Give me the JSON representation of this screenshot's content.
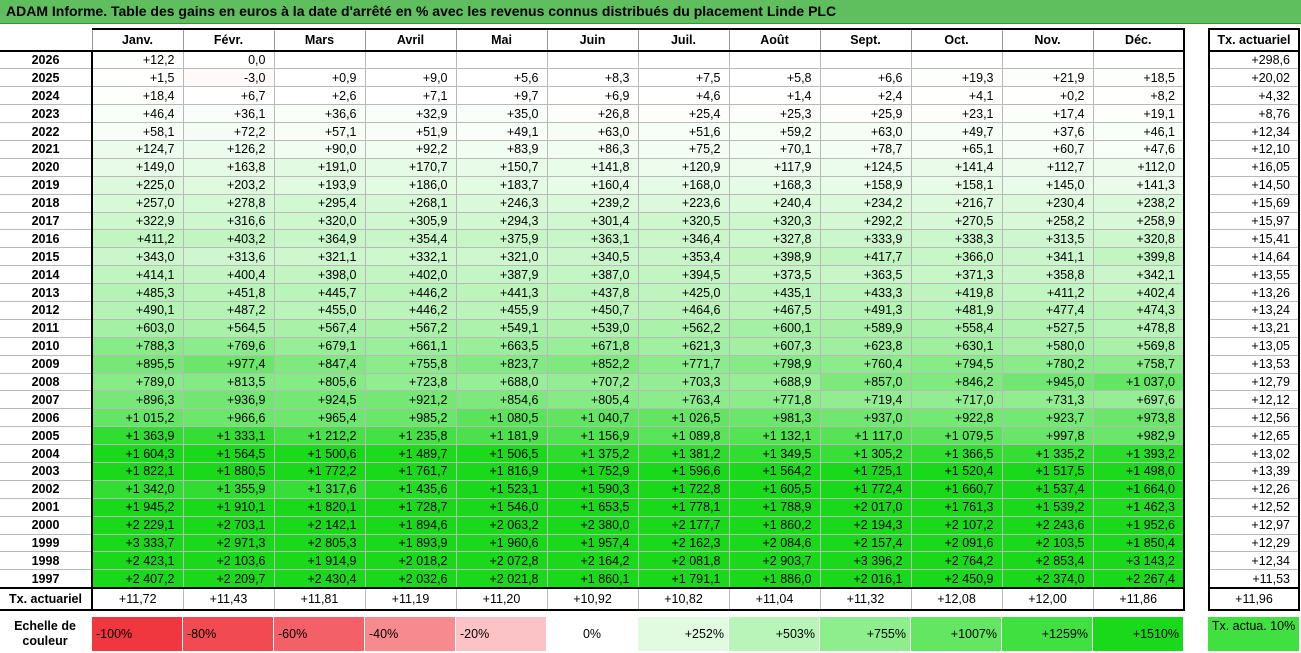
{
  "title": "ADAM Informe. Table des gains en euros à la date d'arrêté en % avec les revenus connus distribués du placement Linde PLC",
  "months": [
    "Janv.",
    "Févr.",
    "Mars",
    "Avril",
    "Mai",
    "Juin",
    "Juil.",
    "Août",
    "Sept.",
    "Oct.",
    "Nov.",
    "Déc."
  ],
  "side_header": "Tx. actuariel",
  "footer_label": "Tx. actuariel",
  "rows": [
    {
      "year": "2026",
      "vals": [
        "+12,2",
        "0,0",
        "",
        "",
        "",
        "",
        "",
        "",
        "",
        "",
        "",
        ""
      ],
      "tx": "+298,6"
    },
    {
      "year": "2025",
      "vals": [
        "+1,5",
        "-3,0",
        "+0,9",
        "+9,0",
        "+5,6",
        "+8,3",
        "+7,5",
        "+5,8",
        "+6,6",
        "+19,3",
        "+21,9",
        "+18,5"
      ],
      "tx": "+20,02"
    },
    {
      "year": "2024",
      "vals": [
        "+18,4",
        "+6,7",
        "+2,6",
        "+7,1",
        "+9,7",
        "+6,9",
        "+4,6",
        "+1,4",
        "+2,4",
        "+4,1",
        "+0,2",
        "+8,2"
      ],
      "tx": "+4,32"
    },
    {
      "year": "2023",
      "vals": [
        "+46,4",
        "+36,1",
        "+36,6",
        "+32,9",
        "+35,0",
        "+26,8",
        "+25,4",
        "+25,3",
        "+25,9",
        "+23,1",
        "+17,4",
        "+19,1"
      ],
      "tx": "+8,76"
    },
    {
      "year": "2022",
      "vals": [
        "+58,1",
        "+72,2",
        "+57,1",
        "+51,9",
        "+49,1",
        "+63,0",
        "+51,6",
        "+59,2",
        "+63,0",
        "+49,7",
        "+37,6",
        "+46,1"
      ],
      "tx": "+12,34"
    },
    {
      "year": "2021",
      "vals": [
        "+124,7",
        "+126,2",
        "+90,0",
        "+92,2",
        "+83,9",
        "+86,3",
        "+75,2",
        "+70,1",
        "+78,7",
        "+65,1",
        "+60,7",
        "+47,6"
      ],
      "tx": "+12,10"
    },
    {
      "year": "2020",
      "vals": [
        "+149,0",
        "+163,8",
        "+191,0",
        "+170,7",
        "+150,7",
        "+141,8",
        "+120,9",
        "+117,9",
        "+124,5",
        "+141,4",
        "+112,7",
        "+112,0"
      ],
      "tx": "+16,05"
    },
    {
      "year": "2019",
      "vals": [
        "+225,0",
        "+203,2",
        "+193,9",
        "+186,0",
        "+183,7",
        "+160,4",
        "+168,0",
        "+168,3",
        "+158,9",
        "+158,1",
        "+145,0",
        "+141,3"
      ],
      "tx": "+14,50"
    },
    {
      "year": "2018",
      "vals": [
        "+257,0",
        "+278,8",
        "+295,4",
        "+268,1",
        "+246,3",
        "+239,2",
        "+223,6",
        "+240,4",
        "+234,2",
        "+216,7",
        "+230,4",
        "+238,2"
      ],
      "tx": "+15,69"
    },
    {
      "year": "2017",
      "vals": [
        "+322,9",
        "+316,6",
        "+320,0",
        "+305,9",
        "+294,3",
        "+301,4",
        "+320,5",
        "+320,3",
        "+292,2",
        "+270,5",
        "+258,2",
        "+258,9"
      ],
      "tx": "+15,97"
    },
    {
      "year": "2016",
      "vals": [
        "+411,2",
        "+403,2",
        "+364,9",
        "+354,4",
        "+375,9",
        "+363,1",
        "+346,4",
        "+327,8",
        "+333,9",
        "+338,3",
        "+313,5",
        "+320,8"
      ],
      "tx": "+15,41"
    },
    {
      "year": "2015",
      "vals": [
        "+343,0",
        "+313,6",
        "+321,1",
        "+332,1",
        "+321,0",
        "+340,5",
        "+353,4",
        "+398,9",
        "+417,7",
        "+366,0",
        "+341,1",
        "+399,8"
      ],
      "tx": "+14,64"
    },
    {
      "year": "2014",
      "vals": [
        "+414,1",
        "+400,4",
        "+398,0",
        "+402,0",
        "+387,9",
        "+387,0",
        "+394,5",
        "+373,5",
        "+363,5",
        "+371,3",
        "+358,8",
        "+342,1"
      ],
      "tx": "+13,55"
    },
    {
      "year": "2013",
      "vals": [
        "+485,3",
        "+451,8",
        "+445,7",
        "+446,2",
        "+441,3",
        "+437,8",
        "+425,0",
        "+435,1",
        "+433,3",
        "+419,8",
        "+411,2",
        "+402,4"
      ],
      "tx": "+13,26"
    },
    {
      "year": "2012",
      "vals": [
        "+490,1",
        "+487,2",
        "+455,0",
        "+446,2",
        "+455,9",
        "+450,7",
        "+464,6",
        "+467,5",
        "+491,3",
        "+481,9",
        "+477,4",
        "+474,3"
      ],
      "tx": "+13,24"
    },
    {
      "year": "2011",
      "vals": [
        "+603,0",
        "+564,5",
        "+567,4",
        "+567,2",
        "+549,1",
        "+539,0",
        "+562,2",
        "+600,1",
        "+589,9",
        "+558,4",
        "+527,5",
        "+478,8"
      ],
      "tx": "+13,21"
    },
    {
      "year": "2010",
      "vals": [
        "+788,3",
        "+769,6",
        "+679,1",
        "+661,1",
        "+663,5",
        "+671,8",
        "+621,3",
        "+607,3",
        "+623,8",
        "+630,1",
        "+580,0",
        "+569,8"
      ],
      "tx": "+13,05"
    },
    {
      "year": "2009",
      "vals": [
        "+895,5",
        "+977,4",
        "+847,4",
        "+755,8",
        "+823,7",
        "+852,2",
        "+771,7",
        "+798,9",
        "+760,4",
        "+794,5",
        "+780,2",
        "+758,7"
      ],
      "tx": "+13,53"
    },
    {
      "year": "2008",
      "vals": [
        "+789,0",
        "+813,5",
        "+805,6",
        "+723,8",
        "+688,0",
        "+707,2",
        "+703,3",
        "+688,9",
        "+857,0",
        "+846,2",
        "+945,0",
        "+1 037,0"
      ],
      "tx": "+12,79"
    },
    {
      "year": "2007",
      "vals": [
        "+896,3",
        "+936,9",
        "+924,5",
        "+921,2",
        "+854,6",
        "+805,4",
        "+763,4",
        "+771,8",
        "+719,4",
        "+717,0",
        "+731,3",
        "+697,6"
      ],
      "tx": "+12,12"
    },
    {
      "year": "2006",
      "vals": [
        "+1 015,2",
        "+966,6",
        "+965,4",
        "+985,2",
        "+1 080,5",
        "+1 040,7",
        "+1 026,5",
        "+981,3",
        "+937,0",
        "+922,8",
        "+923,7",
        "+973,8"
      ],
      "tx": "+12,56"
    },
    {
      "year": "2005",
      "vals": [
        "+1 363,9",
        "+1 333,1",
        "+1 212,2",
        "+1 235,8",
        "+1 181,9",
        "+1 156,9",
        "+1 089,8",
        "+1 132,1",
        "+1 117,0",
        "+1 079,5",
        "+997,8",
        "+982,9"
      ],
      "tx": "+12,65"
    },
    {
      "year": "2004",
      "vals": [
        "+1 604,3",
        "+1 564,5",
        "+1 500,6",
        "+1 489,7",
        "+1 506,5",
        "+1 375,2",
        "+1 381,2",
        "+1 349,5",
        "+1 305,2",
        "+1 366,5",
        "+1 335,2",
        "+1 393,2"
      ],
      "tx": "+13,02"
    },
    {
      "year": "2003",
      "vals": [
        "+1 822,1",
        "+1 880,5",
        "+1 772,2",
        "+1 761,7",
        "+1 816,9",
        "+1 752,9",
        "+1 596,6",
        "+1 564,2",
        "+1 725,1",
        "+1 520,4",
        "+1 517,5",
        "+1 498,0"
      ],
      "tx": "+13,39"
    },
    {
      "year": "2002",
      "vals": [
        "+1 342,0",
        "+1 355,9",
        "+1 317,6",
        "+1 435,6",
        "+1 523,1",
        "+1 590,3",
        "+1 722,8",
        "+1 605,5",
        "+1 772,4",
        "+1 660,7",
        "+1 537,4",
        "+1 664,0"
      ],
      "tx": "+12,26"
    },
    {
      "year": "2001",
      "vals": [
        "+1 945,2",
        "+1 910,1",
        "+1 820,1",
        "+1 728,7",
        "+1 546,0",
        "+1 653,5",
        "+1 778,1",
        "+1 788,9",
        "+2 017,0",
        "+1 761,3",
        "+1 539,2",
        "+1 462,3"
      ],
      "tx": "+12,52"
    },
    {
      "year": "2000",
      "vals": [
        "+2 229,1",
        "+2 703,1",
        "+2 142,1",
        "+1 894,6",
        "+2 063,2",
        "+2 380,0",
        "+2 177,7",
        "+1 860,2",
        "+2 194,3",
        "+2 107,2",
        "+2 243,6",
        "+1 952,6"
      ],
      "tx": "+12,97"
    },
    {
      "year": "1999",
      "vals": [
        "+3 333,7",
        "+2 971,3",
        "+2 805,3",
        "+1 893,9",
        "+1 960,6",
        "+1 957,4",
        "+2 162,3",
        "+2 084,6",
        "+2 157,4",
        "+2 091,6",
        "+2 103,5",
        "+1 850,4"
      ],
      "tx": "+12,29"
    },
    {
      "year": "1998",
      "vals": [
        "+2 423,1",
        "+2 103,6",
        "+1 914,9",
        "+2 018,2",
        "+2 072,8",
        "+2 164,2",
        "+2 081,8",
        "+2 903,7",
        "+3 396,2",
        "+2 764,2",
        "+2 853,4",
        "+3 143,2"
      ],
      "tx": "+12,34"
    },
    {
      "year": "1997",
      "vals": [
        "+2 407,2",
        "+2 209,7",
        "+2 430,4",
        "+2 032,6",
        "+2 021,8",
        "+1 860,1",
        "+1 791,1",
        "+1 886,0",
        "+2 016,1",
        "+2 450,9",
        "+2 374,0",
        "+2 267,4"
      ],
      "tx": "+11,53"
    }
  ],
  "footer_vals": [
    "+11,72",
    "+11,43",
    "+11,81",
    "+11,19",
    "+11,20",
    "+10,92",
    "+10,82",
    "+11,04",
    "+11,32",
    "+12,08",
    "+12,00",
    "+11,86"
  ],
  "footer_tx": "+11,96",
  "legend": {
    "label": "Echelle de couleur",
    "items": [
      {
        "text": "-100%",
        "color": "#f0363f"
      },
      {
        "text": "-80%",
        "color": "#f24a52"
      },
      {
        "text": "-60%",
        "color": "#f46068"
      },
      {
        "text": "-40%",
        "color": "#f78a8f"
      },
      {
        "text": "-20%",
        "color": "#fbc3c5"
      },
      {
        "text": "0%",
        "color": "#ffffff"
      },
      {
        "text": "+252%",
        "color": "#e0fbe0"
      },
      {
        "text": "+503%",
        "color": "#b9f5b9"
      },
      {
        "text": "+755%",
        "color": "#8eee8e"
      },
      {
        "text": "+1007%",
        "color": "#63e763"
      },
      {
        "text": "+1259%",
        "color": "#3fe03f"
      },
      {
        "text": "+1510%",
        "color": "#1ad91a"
      }
    ],
    "side_text": "Tx. actua. 10%",
    "side_color": "#3fe03f"
  },
  "colors": {
    "title_bar": "#5fbf5f",
    "neg": "#fde2e2",
    "max_green": "#1ad91a"
  }
}
